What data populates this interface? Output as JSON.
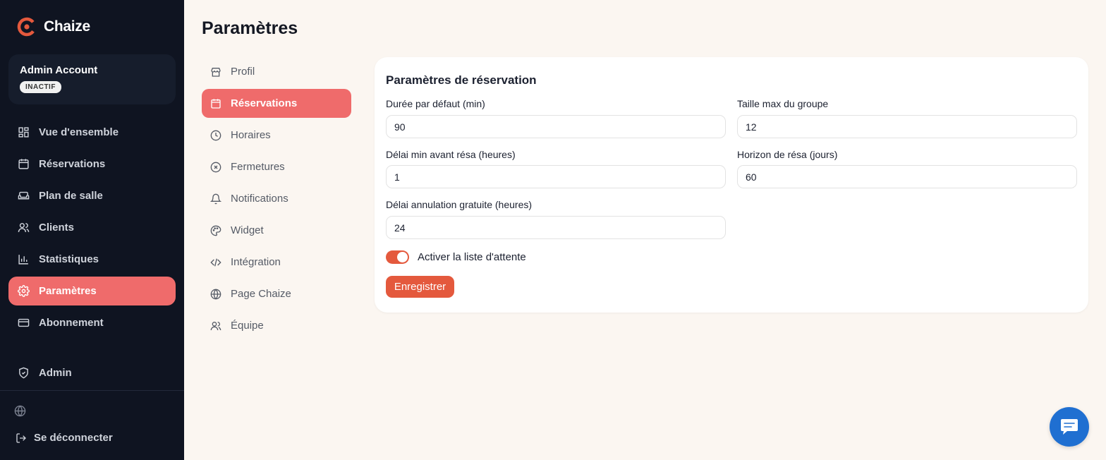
{
  "brand": {
    "name": "Chaize",
    "accent": "#e4593d"
  },
  "account": {
    "name": "Admin Account",
    "status": "INACTIF"
  },
  "sidebar": {
    "items": [
      {
        "label": "Vue d'ensemble",
        "icon": "dashboard-icon"
      },
      {
        "label": "Réservations",
        "icon": "calendar-icon"
      },
      {
        "label": "Plan de salle",
        "icon": "sofa-icon"
      },
      {
        "label": "Clients",
        "icon": "users-icon"
      },
      {
        "label": "Statistiques",
        "icon": "bar-chart-icon"
      },
      {
        "label": "Paramètres",
        "icon": "gear-icon",
        "active": true
      },
      {
        "label": "Abonnement",
        "icon": "credit-card-icon"
      }
    ],
    "admin_label": "Admin",
    "logout_label": "Se déconnecter"
  },
  "page": {
    "title": "Paramètres"
  },
  "settings_nav": {
    "items": [
      {
        "label": "Profil",
        "icon": "store-icon"
      },
      {
        "label": "Réservations",
        "icon": "calendar-icon",
        "active": true
      },
      {
        "label": "Horaires",
        "icon": "clock-icon"
      },
      {
        "label": "Fermetures",
        "icon": "x-circle-icon"
      },
      {
        "label": "Notifications",
        "icon": "bell-icon"
      },
      {
        "label": "Widget",
        "icon": "palette-icon"
      },
      {
        "label": "Intégration",
        "icon": "code-icon"
      },
      {
        "label": "Page Chaize",
        "icon": "globe-icon"
      },
      {
        "label": "Équipe",
        "icon": "users-icon"
      }
    ]
  },
  "form": {
    "title": "Paramètres de réservation",
    "fields": {
      "default_duration": {
        "label": "Durée par défaut (min)",
        "value": "90"
      },
      "max_group": {
        "label": "Taille max du groupe",
        "value": "12"
      },
      "min_delay": {
        "label": "Délai min avant résa (heures)",
        "value": "1"
      },
      "horizon": {
        "label": "Horizon de résa (jours)",
        "value": "60"
      },
      "free_cancel": {
        "label": "Délai annulation gratuite (heures)",
        "value": "24"
      }
    },
    "waitlist": {
      "label": "Activer la liste d'attente",
      "enabled": true
    },
    "save_label": "Enregistrer"
  }
}
